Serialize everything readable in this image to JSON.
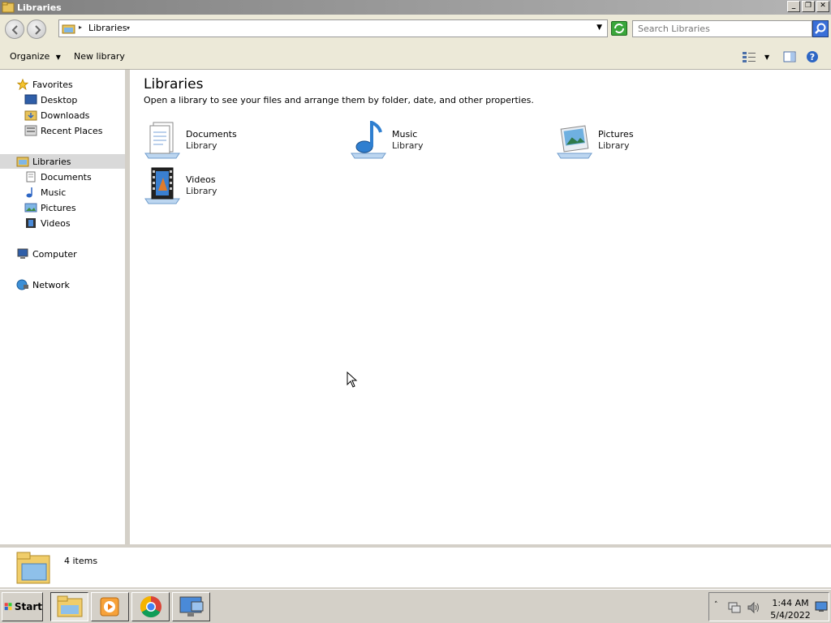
{
  "window": {
    "title": "Libraries"
  },
  "address": {
    "crumb": "Libraries",
    "search_placeholder": "Search Libraries"
  },
  "toolbar": {
    "organize_label": "Organize",
    "new_library_label": "New library"
  },
  "nav": {
    "favorites": {
      "label": "Favorites",
      "items": [
        "Desktop",
        "Downloads",
        "Recent Places"
      ]
    },
    "libraries": {
      "label": "Libraries",
      "items": [
        "Documents",
        "Music",
        "Pictures",
        "Videos"
      ]
    },
    "computer": "Computer",
    "network": "Network"
  },
  "main": {
    "heading": "Libraries",
    "subtitle": "Open a library to see your files and arrange them by folder, date, and other properties.",
    "libraries": [
      {
        "name": "Documents",
        "kind": "Library",
        "icon": "documents-library-icon"
      },
      {
        "name": "Music",
        "kind": "Library",
        "icon": "music-library-icon"
      },
      {
        "name": "Pictures",
        "kind": "Library",
        "icon": "pictures-library-icon"
      },
      {
        "name": "Videos",
        "kind": "Library",
        "icon": "videos-library-icon"
      }
    ]
  },
  "details": {
    "count": "4 items"
  },
  "taskbar": {
    "start_label": "Start",
    "time": "1:44 AM",
    "date": "5/4/2022"
  },
  "colors": {
    "selection": "#d9d9d9",
    "frame": "#d4d0c8",
    "title_gradient_start": "#808080"
  }
}
